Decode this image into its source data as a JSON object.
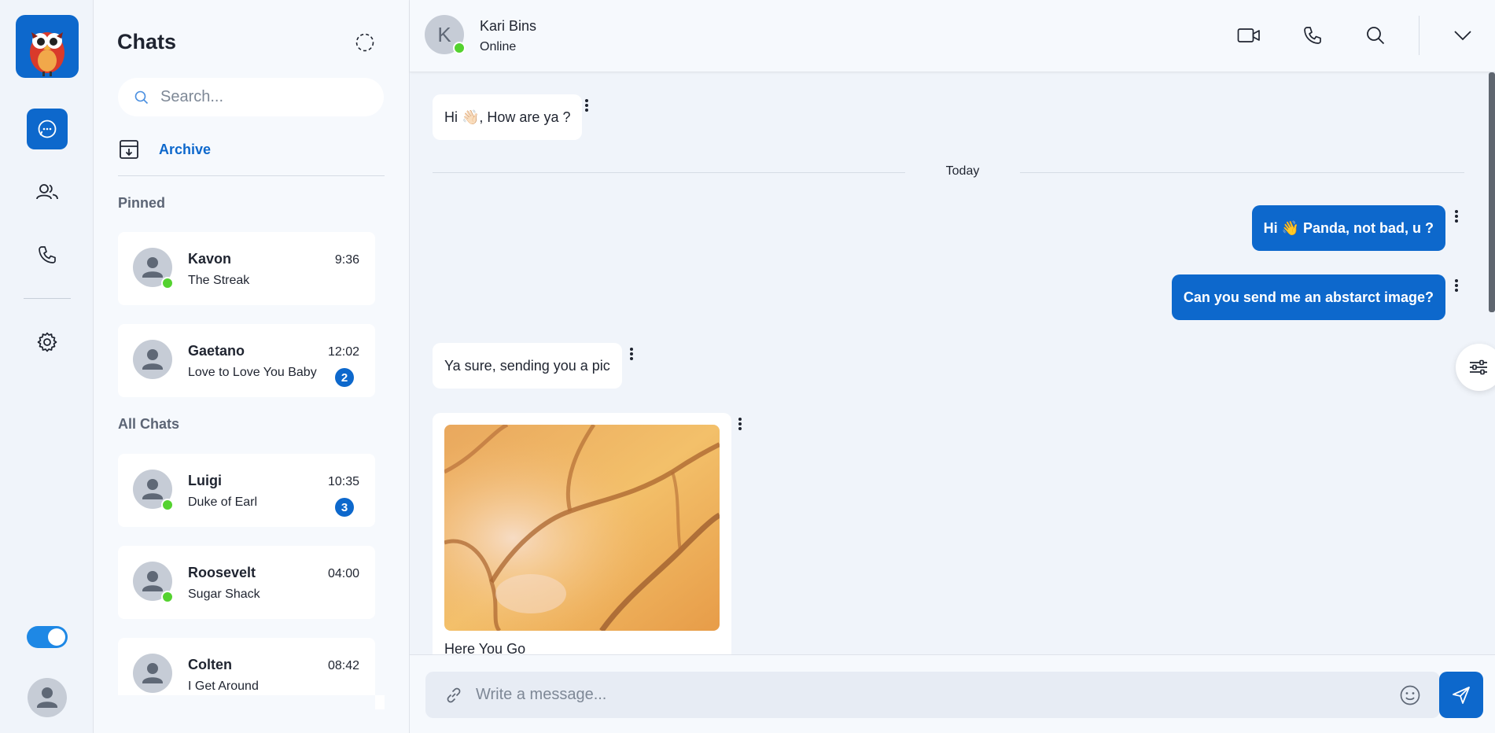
{
  "rail": {
    "icons": [
      "chat-icon",
      "users-icon",
      "phone-icon",
      "gear-icon",
      "user-avatar-icon"
    ],
    "theme_toggle": "on",
    "accent": "#0d68cc"
  },
  "list": {
    "title": "Chats",
    "search_placeholder": "Search...",
    "archive_label": "Archive",
    "pinned_label": "Pinned",
    "all_label": "All Chats",
    "pinned": [
      {
        "name": "Kavon",
        "preview": "The Streak",
        "time": "9:36",
        "online": true,
        "unread": ""
      },
      {
        "name": "Gaetano",
        "preview": "Love to Love You Baby",
        "time": "12:02",
        "online": false,
        "unread": "2"
      }
    ],
    "chats": [
      {
        "name": "Luigi",
        "preview": "Duke of Earl",
        "time": "10:35",
        "online": true,
        "unread": "3"
      },
      {
        "name": "Roosevelt",
        "preview": "Sugar Shack",
        "time": "04:00",
        "online": true,
        "unread": ""
      },
      {
        "name": "Colten",
        "preview": "I Get Around",
        "time": "08:42",
        "online": false,
        "unread": ""
      }
    ]
  },
  "conversation": {
    "contact_initial": "K",
    "contact_name": "Kari Bins",
    "contact_status": "Online",
    "day_label": "Today",
    "messages": [
      {
        "dir": "in",
        "text": "Hi 👋🏻, How are ya ?"
      },
      {
        "dir": "out",
        "text": "Hi 👋 Panda, not bad, u ?"
      },
      {
        "dir": "out",
        "text": "Can you send me an abstarct image?"
      },
      {
        "dir": "in",
        "text": "Ya sure, sending you a pic"
      },
      {
        "dir": "in",
        "type": "image",
        "caption": "Here You Go"
      }
    ],
    "composer_placeholder": "Write a message..."
  }
}
